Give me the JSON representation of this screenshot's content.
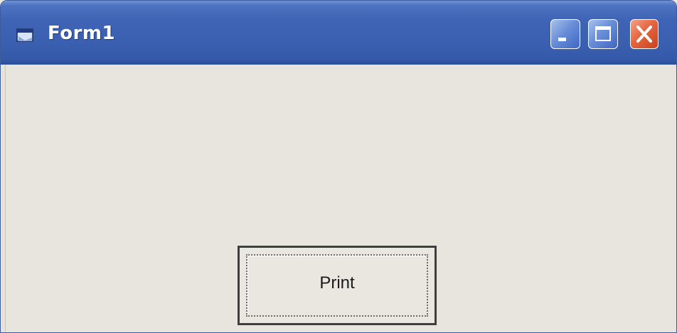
{
  "window": {
    "title": "Form1",
    "controls": {
      "minimize_icon": "minimize-icon",
      "maximize_icon": "maximize-icon",
      "close_icon": "close-icon"
    }
  },
  "form": {
    "print_button_label": "Print"
  },
  "colors": {
    "titlebar": "#3a5fb0",
    "client_background": "#e7e5dd",
    "close_button": "#e4663f"
  }
}
